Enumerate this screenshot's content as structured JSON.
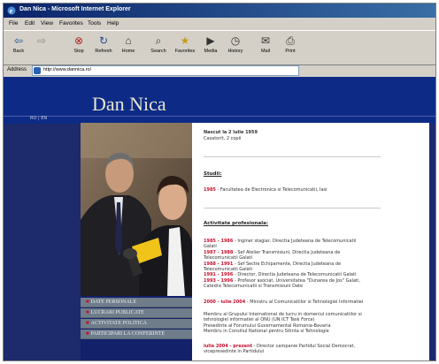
{
  "browser": {
    "title": "Dan Nica - Microsoft Internet Explorer",
    "menu": [
      "File",
      "Edit",
      "View",
      "Favorites",
      "Tools",
      "Help"
    ],
    "toolbar": [
      {
        "label": "Back",
        "icon": "back-icon"
      },
      {
        "label": "",
        "icon": "forward-icon"
      },
      {
        "label": "Stop",
        "icon": "stop-icon"
      },
      {
        "label": "Refresh",
        "icon": "refresh-icon"
      },
      {
        "label": "Home",
        "icon": "home-icon"
      },
      {
        "label": "Search",
        "icon": "search-icon"
      },
      {
        "label": "Favorites",
        "icon": "favorites-icon"
      },
      {
        "label": "Media",
        "icon": "media-icon"
      },
      {
        "label": "History",
        "icon": "history-icon"
      },
      {
        "label": "Mail",
        "icon": "mail-icon"
      },
      {
        "label": "Print",
        "icon": "print-icon"
      }
    ],
    "address_label": "Address",
    "address_value": "http://www.dannica.ro/"
  },
  "site": {
    "name": "Dan Nica",
    "lang_switch": "RO | EN",
    "menu": [
      "DATE PERSONALE",
      "LUCRARI PUBLICATE",
      "ACTIVITATE POLITICA",
      "PARTICIPARI LA CONFERINTE"
    ],
    "bio": {
      "born": "Nascut la 2 iulie 1959",
      "status": "Casatorit, 2 copii"
    },
    "studies": {
      "heading": "Studii:",
      "year": "1985",
      "text": " - Facultatea de Electronica si Telecomunicatii, Iasi"
    },
    "professional": {
      "heading": "Activitate profesionala:",
      "entries": [
        {
          "years": "1985 - 1986",
          "lines": [
            " - Inginer stagiar, Directia Judeteana de Telecomunicatii",
            "Galati"
          ]
        },
        {
          "years": "1987 - 1988",
          "lines": [
            " - Sef Atelier Transmisiuni, Directia Judeteana de",
            "Telecomunicatii Galati"
          ]
        },
        {
          "years": "1988 - 1991",
          "lines": [
            " - Sef Sectie Echipamente, Directia Judeteana de",
            "Telecomunicatii Galati"
          ]
        },
        {
          "years": "1991 - 1996",
          "lines": [
            " - Director, Directia Judeteana de Telecomunicatii Galati"
          ]
        },
        {
          "years": "1993 - 1996",
          "lines": [
            " - Profesor asociat, Universitatea \"Dunarea de Jos\" Galati,",
            "Catedra Telecomunicatii si Transmisiuni Date"
          ]
        }
      ]
    },
    "ministry": {
      "years": "2000 - iulie 2004",
      "text": " - Ministru al Comunicatiilor si Tehnologiei Informatiei"
    },
    "membership": {
      "lines": [
        "Membru al Grupului International de lucru in domeniul comunicatiilor si",
        "tehnologiei informatiei al ONU (UN ICT Task Force)",
        "Presedinte al Forumului Guvernamental Romania-Bavaria",
        "Membru in Consiliul National pentru Stiinta si Tehnologie"
      ],
      "highlight_1": "UN ICT Task Force",
      "highlight_2": "Forumului Guvernamental Romania-Bavaria"
    },
    "current": {
      "years": "iulie 2004 - prezent",
      "lines": [
        " - Director campanie Partidul Social Democrat,",
        "vicepresedinte in Partidului"
      ]
    }
  }
}
